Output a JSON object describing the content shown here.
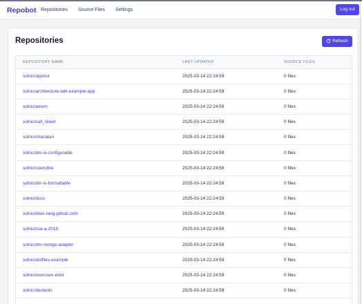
{
  "navbar": {
    "brand": "Repobot",
    "links": [
      "Repositories",
      "Source Files",
      "Settings"
    ],
    "logout_label": "Log out"
  },
  "page": {
    "title": "Repositories",
    "refresh_label": "Refresh"
  },
  "table": {
    "columns": [
      "REPOSITORY NAME",
      "LAST UPDATED",
      "SOURCE FILES"
    ],
    "rows": [
      {
        "name": "solnic/alpinist",
        "updated": "2025-03-14 22:24:59",
        "files": "0 files"
      },
      {
        "name": "solnic/architecture-talk-example-app",
        "updated": "2025-03-14 22:24:59",
        "files": "0 files"
      },
      {
        "name": "solnic/axiom",
        "updated": "2025-03-14 22:24:59",
        "files": "0 files"
      },
      {
        "name": "solnic/call_sheet",
        "updated": "2025-03-14 22:24:59",
        "files": "0 files"
      },
      {
        "name": "solnic/charlatan",
        "updated": "2025-03-14 22:24:59",
        "files": "0 files"
      },
      {
        "name": "solnic/dm-is-configurable",
        "updated": "2025-03-14 22:24:59",
        "files": "0 files"
      },
      {
        "name": "solnic/coercible",
        "updated": "2025-03-14 22:24:59",
        "files": "0 files"
      },
      {
        "name": "solnic/dm-is-formattable",
        "updated": "2025-03-14 22:24:59",
        "files": "0 files"
      },
      {
        "name": "solnic/docs",
        "updated": "2025-03-14 22:24:59",
        "files": "0 files"
      },
      {
        "name": "solnic/elixir-lang.github.com",
        "updated": "2025-03-14 22:24:59",
        "files": "0 files"
      },
      {
        "name": "solnic/csa-a-2018",
        "updated": "2025-03-14 22:24:59",
        "files": "0 files"
      },
      {
        "name": "solnic/dm-mongo-adapter",
        "updated": "2025-03-14 22:24:59",
        "files": "0 files"
      },
      {
        "name": "solnic/dotfiles-example",
        "updated": "2025-03-14 22:24:59",
        "files": "0 files"
      },
      {
        "name": "solnic/exercism-elixir",
        "updated": "2025-03-14 22:24:59",
        "files": "0 files"
      },
      {
        "name": "solnic/devtools",
        "updated": "2025-03-14 22:24:59",
        "files": "0 files"
      }
    ]
  }
}
